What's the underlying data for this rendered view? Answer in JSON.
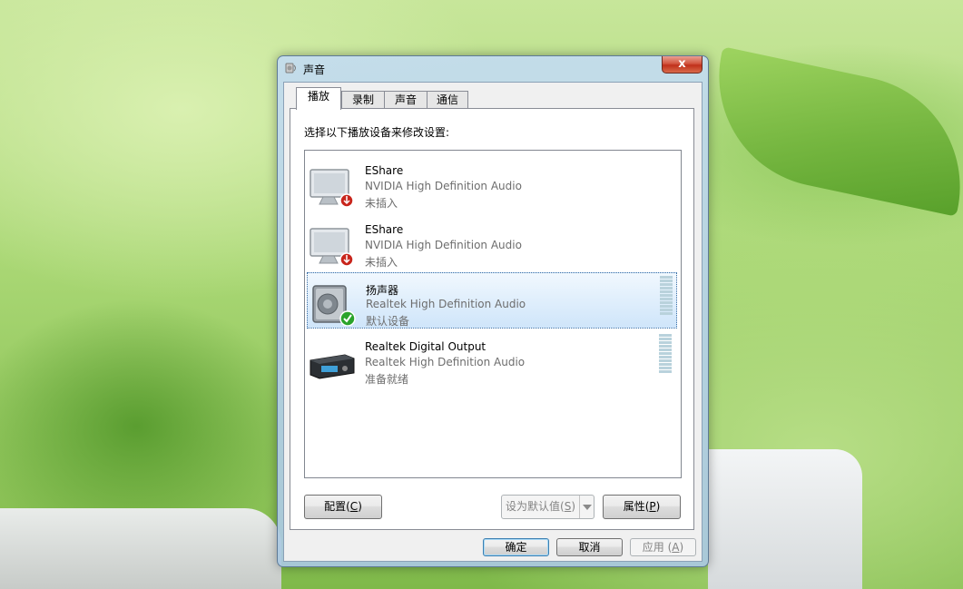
{
  "window": {
    "title": "声音",
    "close_glyph": "x"
  },
  "tabs": [
    {
      "label": "播放",
      "active": true
    },
    {
      "label": "录制",
      "active": false
    },
    {
      "label": "声音",
      "active": false
    },
    {
      "label": "通信",
      "active": false
    }
  ],
  "playback": {
    "instruction": "选择以下播放设备来修改设置:",
    "devices": [
      {
        "name": "EShare",
        "driver": "NVIDIA High Definition Audio",
        "status": "未插入",
        "icon": "monitor-icon",
        "badge": "unplugged-badge-icon",
        "selected": false
      },
      {
        "name": "EShare",
        "driver": "NVIDIA High Definition Audio",
        "status": "未插入",
        "icon": "monitor-icon",
        "badge": "unplugged-badge-icon",
        "selected": false
      },
      {
        "name": "扬声器",
        "driver": "Realtek High Definition Audio",
        "status": "默认设备",
        "icon": "speaker-icon",
        "badge": "default-check-icon",
        "selected": true
      },
      {
        "name": "Realtek Digital Output",
        "driver": "Realtek High Definition Audio",
        "status": "准备就绪",
        "icon": "digital-receiver-icon",
        "badge": "",
        "selected": false
      }
    ],
    "buttons": {
      "configure_prefix": "配置(",
      "configure_key": "C",
      "configure_suffix": ")",
      "set_default_prefix": "设为默认值(",
      "set_default_key": "S",
      "set_default_suffix": ")",
      "properties_prefix": "属性(",
      "properties_key": "P",
      "properties_suffix": ")"
    }
  },
  "dialog_buttons": {
    "ok": "确定",
    "cancel": "取消",
    "apply_prefix": "应用 (",
    "apply_key": "A",
    "apply_suffix": ")"
  },
  "colors": {
    "selection_border": "#3a6ea5",
    "close_red": "#c0301b",
    "badge_red": "#c8251c",
    "badge_green": "#2aa32a"
  }
}
